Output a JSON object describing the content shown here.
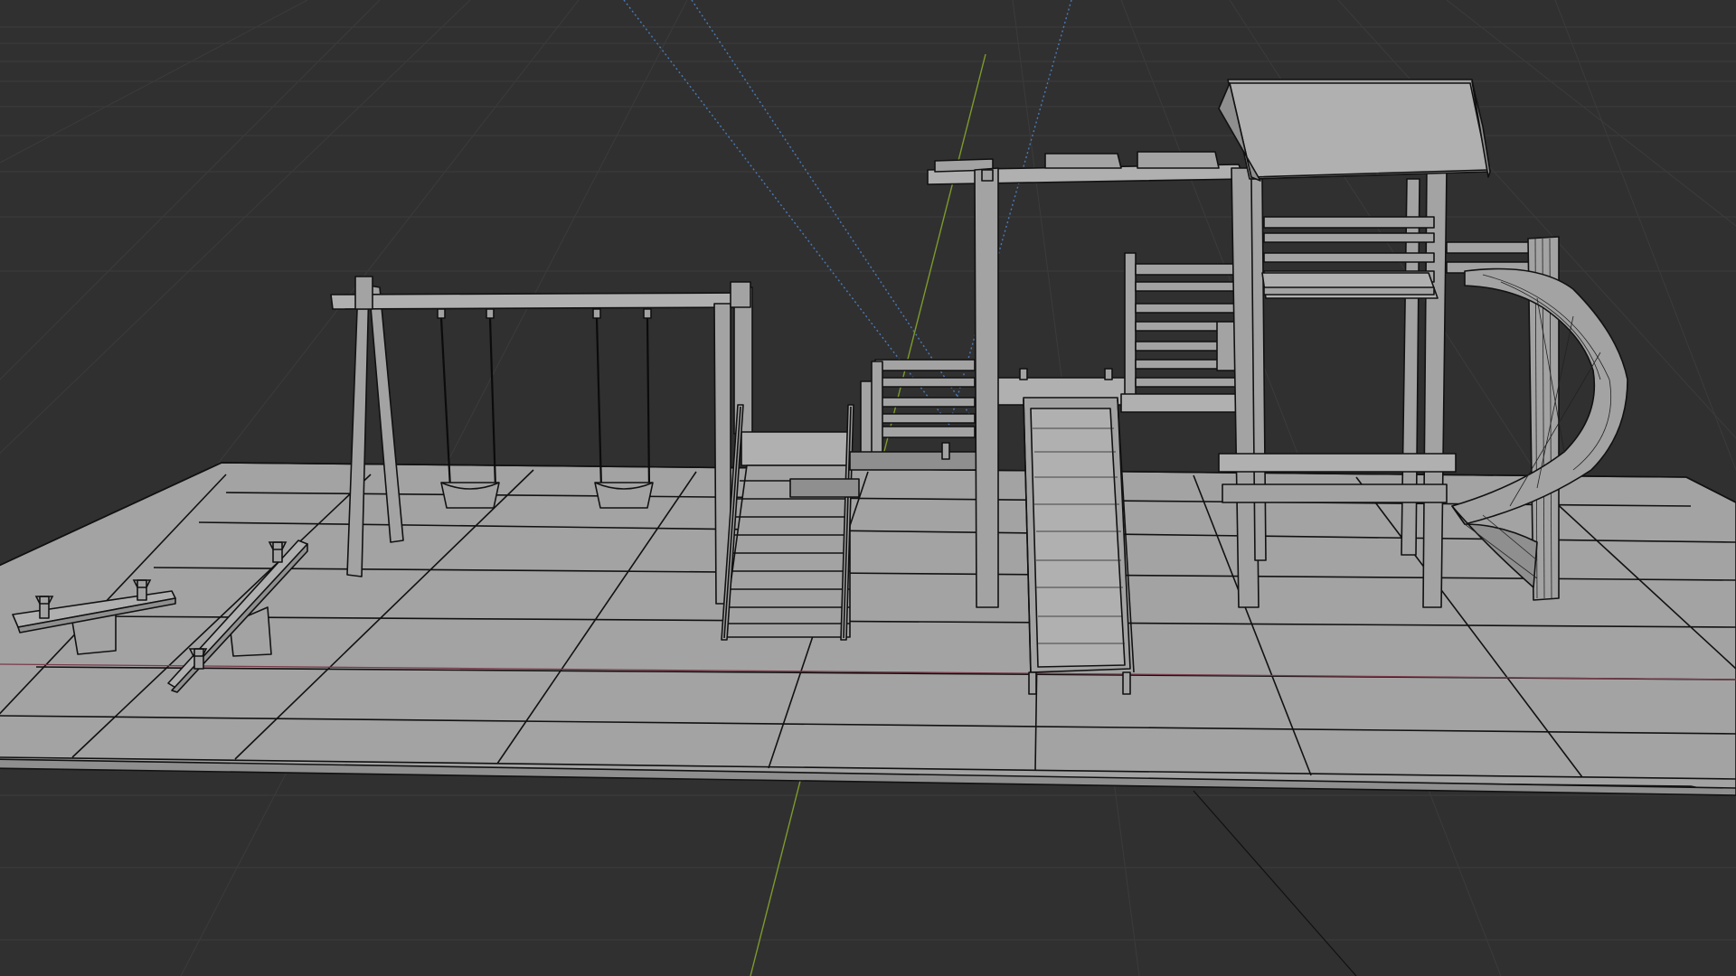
{
  "viewport": {
    "background_color": "#303030",
    "grid_color": "#3a3a3a",
    "x_axis_color": "#8a3a3a",
    "y_axis_color": "#7d9a2c",
    "camera_guide_color": "#4a7ab8",
    "mesh_color": "#a3a3a3",
    "wire_color": "#111111",
    "objects": [
      "ground-plate",
      "seesaw-left",
      "seesaw-right",
      "swing-set",
      "swing-seat-left",
      "swing-seat-right",
      "stairs",
      "climbing-frame",
      "platform",
      "ladder-railing",
      "slide-ramp",
      "tower",
      "tower-roof",
      "monkey-bars",
      "spiral-slide"
    ]
  }
}
